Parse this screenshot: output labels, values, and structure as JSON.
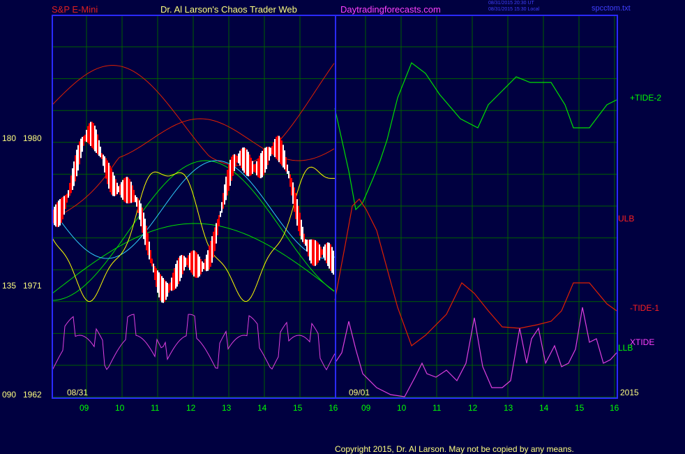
{
  "header": {
    "instrument": "S&P E-Mini",
    "site_title": "Dr. Al Larson's Chaos Trader Web",
    "url": "Daytradingforecasts.com",
    "timestamp_ut": "08/31/2015 20:30 UT",
    "timestamp_local": "08/31/2015 15:30 Local",
    "file": "spcctom.txt"
  },
  "footer": {
    "copyright": "Copyright 2015, Dr. Al Larson. May not be copied by any means."
  },
  "colors": {
    "background": "#000040",
    "frame": "#2a2aff",
    "grid": "#006000",
    "price_up": "#ffffff",
    "price_down": "#ff0000",
    "tide_plus": "#00e000",
    "tide_minus": "#e02000",
    "xtide": "#e040e0",
    "ma_fast": "#ffff00",
    "ma_slow": "#30d0ff",
    "label_yellow": "#ffff80",
    "label_green": "#00ff00"
  },
  "chart_data": {
    "type": "line",
    "y_axis": {
      "ticks": [
        {
          "angle": "090",
          "price": "1962",
          "value": 1962
        },
        {
          "angle": "135",
          "price": "1971",
          "value": 1971
        },
        {
          "angle": "180",
          "price": "1980",
          "value": 1980
        }
      ]
    },
    "x_axis": {
      "hour_labels": [
        "09",
        "10",
        "11",
        "12",
        "13",
        "14",
        "15",
        "16",
        "09",
        "10",
        "11",
        "12",
        "13",
        "14",
        "15",
        "16"
      ],
      "date_labels": [
        "08/31",
        "09/01"
      ],
      "year_label": "2015"
    },
    "series_labels": [
      "+TIDE-2",
      "ULB",
      "-TIDE-1",
      "XTIDE",
      "LLB"
    ],
    "series": [
      {
        "name": "+TIDE-2",
        "color": "#00e000",
        "points": [
          [
            480,
            155
          ],
          [
            500,
            245
          ],
          [
            510,
            300
          ],
          [
            520,
            290
          ],
          [
            535,
            255
          ],
          [
            545,
            230
          ],
          [
            555,
            200
          ],
          [
            570,
            140
          ],
          [
            590,
            90
          ],
          [
            610,
            105
          ],
          [
            630,
            135
          ],
          [
            660,
            170
          ],
          [
            685,
            183
          ],
          [
            700,
            150
          ],
          [
            720,
            130
          ],
          [
            740,
            110
          ],
          [
            760,
            118
          ],
          [
            790,
            118
          ],
          [
            810,
            150
          ],
          [
            822,
            183
          ],
          [
            845,
            183
          ],
          [
            870,
            150
          ],
          [
            884,
            143
          ]
        ]
      },
      {
        "name": "-TIDE-1",
        "color": "#e02000",
        "points": [
          [
            480,
            430
          ],
          [
            495,
            350
          ],
          [
            505,
            295
          ],
          [
            515,
            285
          ],
          [
            525,
            300
          ],
          [
            540,
            330
          ],
          [
            555,
            385
          ],
          [
            570,
            440
          ],
          [
            590,
            495
          ],
          [
            610,
            480
          ],
          [
            640,
            450
          ],
          [
            662,
            405
          ],
          [
            680,
            420
          ],
          [
            700,
            445
          ],
          [
            720,
            468
          ],
          [
            745,
            470
          ],
          [
            770,
            465
          ],
          [
            790,
            460
          ],
          [
            805,
            445
          ],
          [
            822,
            405
          ],
          [
            845,
            405
          ],
          [
            870,
            435
          ],
          [
            884,
            445
          ]
        ]
      },
      {
        "name": "XTIDE",
        "color": "#e040e0",
        "points": [
          [
            480,
            520
          ],
          [
            490,
            505
          ],
          [
            500,
            460
          ],
          [
            510,
            500
          ],
          [
            520,
            535
          ],
          [
            540,
            555
          ],
          [
            560,
            565
          ],
          [
            580,
            568
          ],
          [
            595,
            540
          ],
          [
            605,
            520
          ],
          [
            612,
            535
          ],
          [
            625,
            540
          ],
          [
            640,
            530
          ],
          [
            655,
            545
          ],
          [
            668,
            520
          ],
          [
            680,
            455
          ],
          [
            692,
            525
          ],
          [
            705,
            555
          ],
          [
            720,
            555
          ],
          [
            732,
            545
          ],
          [
            745,
            470
          ],
          [
            755,
            520
          ],
          [
            762,
            485
          ],
          [
            772,
            470
          ],
          [
            782,
            520
          ],
          [
            795,
            495
          ],
          [
            805,
            525
          ],
          [
            815,
            520
          ],
          [
            825,
            500
          ],
          [
            835,
            440
          ],
          [
            845,
            490
          ],
          [
            855,
            485
          ],
          [
            865,
            520
          ],
          [
            875,
            515
          ],
          [
            884,
            505
          ]
        ]
      }
    ]
  }
}
